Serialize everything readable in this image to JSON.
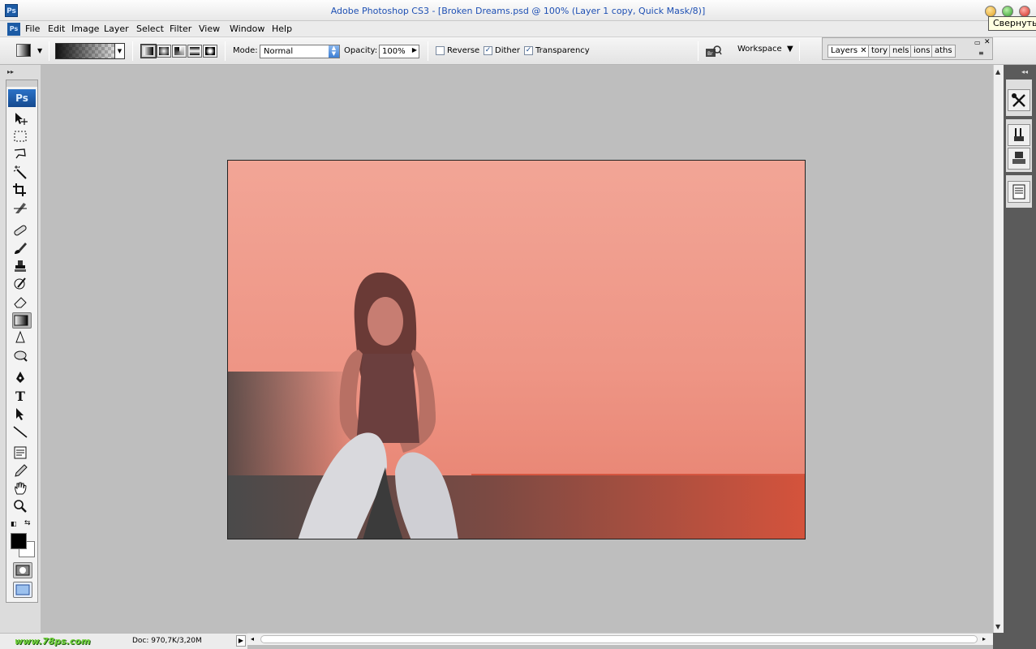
{
  "window": {
    "app_icon": "Ps",
    "title": "Adobe Photoshop CS3 - [Broken Dreams.psd @ 100% (Layer 1 copy, Quick Mask/8)]",
    "tooltip": "Свернуть"
  },
  "menu": {
    "logo": "Ps",
    "items": [
      "File",
      "Edit",
      "Image",
      "Layer",
      "Select",
      "Filter",
      "View",
      "Window",
      "Help"
    ]
  },
  "options": {
    "mode_label": "Mode:",
    "mode_value": "Normal",
    "opacity_label": "Opacity:",
    "opacity_value": "100%",
    "reverse_label": "Reverse",
    "reverse_checked": false,
    "dither_label": "Dither",
    "dither_checked": true,
    "transparency_label": "Transparency",
    "transparency_checked": true,
    "workspace_label": "Workspace"
  },
  "dock": {
    "tabs": [
      "Layers",
      "tory",
      "nels",
      "ions",
      "aths"
    ]
  },
  "toolbox": {
    "badge": "Ps"
  },
  "status": {
    "site_logo": "www.78ps.com",
    "doc_info": "Doc: 970,7K/3,20M"
  },
  "colors": {
    "foreground": "#000000",
    "background": "#ffffff"
  }
}
